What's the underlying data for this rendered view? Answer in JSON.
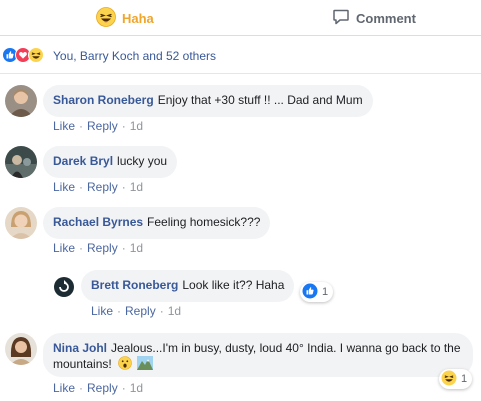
{
  "actions": {
    "haha_label": "Haha",
    "comment_label": "Comment"
  },
  "reactions": {
    "summary": "You, Barry Koch and 52 others"
  },
  "links": {
    "like": "Like",
    "reply": "Reply",
    "dot": "·"
  },
  "comments": [
    {
      "author": "Sharon Roneberg",
      "text": "Enjoy that +30 stuff !! ... Dad and Mum",
      "time": "1d"
    },
    {
      "author": "Darek Bryl",
      "text": "lucky you",
      "time": "1d"
    },
    {
      "author": "Rachael Byrnes",
      "text": "Feeling homesick???",
      "time": "1d"
    },
    {
      "author": "Brett Roneberg",
      "text": "Look like it?? Haha",
      "time": "1d",
      "reaction_count": "1"
    },
    {
      "author": "Nina Johl",
      "text": "Jealous...I'm in busy, dusty, loud 40° India. I wanna go back to the mountains!",
      "time": "1d",
      "reaction_count": "1"
    }
  ],
  "icons": {
    "haha": "laughing-face-icon",
    "comment": "speech-bubble-icon",
    "like": "thumbs-up-icon",
    "love": "heart-icon",
    "colors": {
      "haha": "#f0a52b",
      "like": "#1877f2",
      "love": "#f33e58",
      "link": "#385898"
    }
  }
}
